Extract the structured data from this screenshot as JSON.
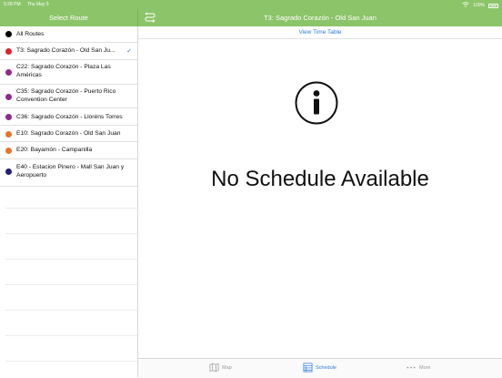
{
  "status_bar": {
    "time": "5:28 PM",
    "date": "Thu May 9",
    "battery": "100%"
  },
  "sidebar": {
    "title": "Select Route",
    "routes": [
      {
        "label": "All Routes",
        "color": "#000000",
        "selected": false
      },
      {
        "label": "T3: Sagrado Corazón - Old San Ju...",
        "color": "#e0212b",
        "selected": true
      },
      {
        "label": "C22: Sagrado Corazón - Plaza Las Américas",
        "color": "#8e2a91",
        "selected": false
      },
      {
        "label": "C35: Sagrado Corazón - Puerto Rico Convention Center",
        "color": "#8e2a91",
        "selected": false
      },
      {
        "label": "C36: Sagrado Corazón - Lloréns Torres",
        "color": "#8e2a91",
        "selected": false
      },
      {
        "label": "E10: Sagrado Corazón - Old San Juan",
        "color": "#e8732a",
        "selected": false
      },
      {
        "label": "E20: Bayamón - Campanilla",
        "color": "#e8732a",
        "selected": false
      },
      {
        "label": "E40 - Estacion Pinero - Mall San Juan y Aeropuerto",
        "color": "#1f1f7a",
        "selected": false
      }
    ]
  },
  "main": {
    "title": "T3: Sagrado Corazón - Old San Juan",
    "view_time_table": "View Time Table",
    "empty_message": "No Schedule Available"
  },
  "tabs": [
    {
      "label": "Map",
      "icon": "map-icon",
      "active": false
    },
    {
      "label": "Schedule",
      "icon": "schedule-icon",
      "active": true
    },
    {
      "label": "More",
      "icon": "more-icon",
      "active": false
    }
  ]
}
